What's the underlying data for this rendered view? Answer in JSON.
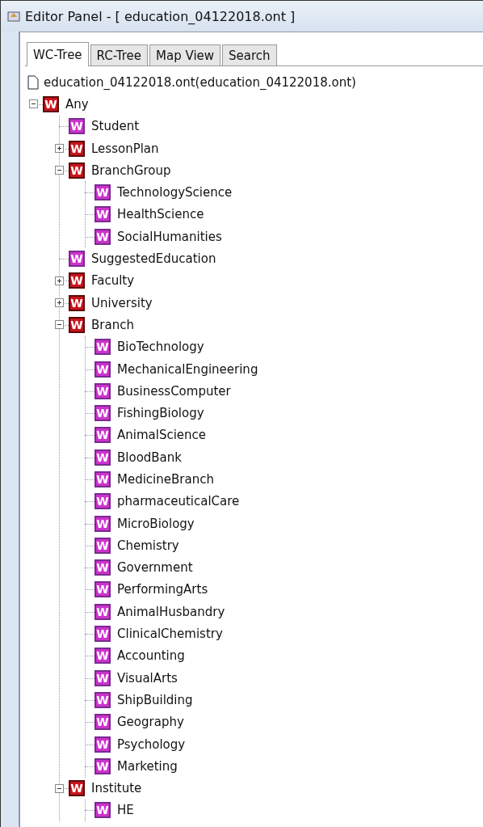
{
  "window": {
    "title": "Editor Panel - [ education_04122018.ont ]"
  },
  "tabs": [
    {
      "label": "WC-Tree",
      "selected": true
    },
    {
      "label": "RC-Tree",
      "selected": false
    },
    {
      "label": "Map View",
      "selected": false
    },
    {
      "label": "Search",
      "selected": false
    }
  ],
  "tree": {
    "file": "education_04122018.ont(education_04122018.ont)",
    "nodes": [
      {
        "label": "Any",
        "badge": "W",
        "kind": "class",
        "expanded": true,
        "children": [
          {
            "label": "Student",
            "badge": "W",
            "kind": "leaf"
          },
          {
            "label": "LessonPlan",
            "badge": "W",
            "kind": "class",
            "expanded": false
          },
          {
            "label": "BranchGroup",
            "badge": "W",
            "kind": "class",
            "expanded": true,
            "children": [
              {
                "label": "TechnologyScience",
                "badge": "W",
                "kind": "leaf"
              },
              {
                "label": "HealthScience",
                "badge": "W",
                "kind": "leaf"
              },
              {
                "label": "SocialHumanities",
                "badge": "W",
                "kind": "leaf"
              }
            ]
          },
          {
            "label": "SuggestedEducation",
            "badge": "W",
            "kind": "leaf"
          },
          {
            "label": "Faculty",
            "badge": "W",
            "kind": "class",
            "expanded": false
          },
          {
            "label": "University",
            "badge": "W",
            "kind": "class",
            "expanded": false
          },
          {
            "label": "Branch",
            "badge": "W",
            "kind": "class",
            "expanded": true,
            "children": [
              {
                "label": "BioTechnology",
                "badge": "W",
                "kind": "leaf"
              },
              {
                "label": "MechanicalEngineering",
                "badge": "W",
                "kind": "leaf"
              },
              {
                "label": "BusinessComputer",
                "badge": "W",
                "kind": "leaf"
              },
              {
                "label": "FishingBiology",
                "badge": "W",
                "kind": "leaf"
              },
              {
                "label": "AnimalScience",
                "badge": "W",
                "kind": "leaf"
              },
              {
                "label": "BloodBank",
                "badge": "W",
                "kind": "leaf"
              },
              {
                "label": "MedicineBranch",
                "badge": "W",
                "kind": "leaf"
              },
              {
                "label": "pharmaceuticalCare",
                "badge": "W",
                "kind": "leaf"
              },
              {
                "label": "MicroBiology",
                "badge": "W",
                "kind": "leaf"
              },
              {
                "label": "Chemistry",
                "badge": "W",
                "kind": "leaf"
              },
              {
                "label": "Government",
                "badge": "W",
                "kind": "leaf"
              },
              {
                "label": "PerformingArts",
                "badge": "W",
                "kind": "leaf"
              },
              {
                "label": "AnimalHusbandry",
                "badge": "W",
                "kind": "leaf"
              },
              {
                "label": "ClinicalChemistry",
                "badge": "W",
                "kind": "leaf"
              },
              {
                "label": "Accounting",
                "badge": "W",
                "kind": "leaf"
              },
              {
                "label": "VisualArts",
                "badge": "W",
                "kind": "leaf"
              },
              {
                "label": "ShipBuilding",
                "badge": "W",
                "kind": "leaf"
              },
              {
                "label": "Geography",
                "badge": "W",
                "kind": "leaf"
              },
              {
                "label": "Psychology",
                "badge": "W",
                "kind": "leaf"
              },
              {
                "label": "Marketing",
                "badge": "W",
                "kind": "leaf"
              }
            ]
          },
          {
            "label": "Institute",
            "badge": "W",
            "kind": "class",
            "expanded": true,
            "children": [
              {
                "label": "HE",
                "badge": "W",
                "kind": "leaf"
              }
            ]
          }
        ]
      }
    ]
  }
}
